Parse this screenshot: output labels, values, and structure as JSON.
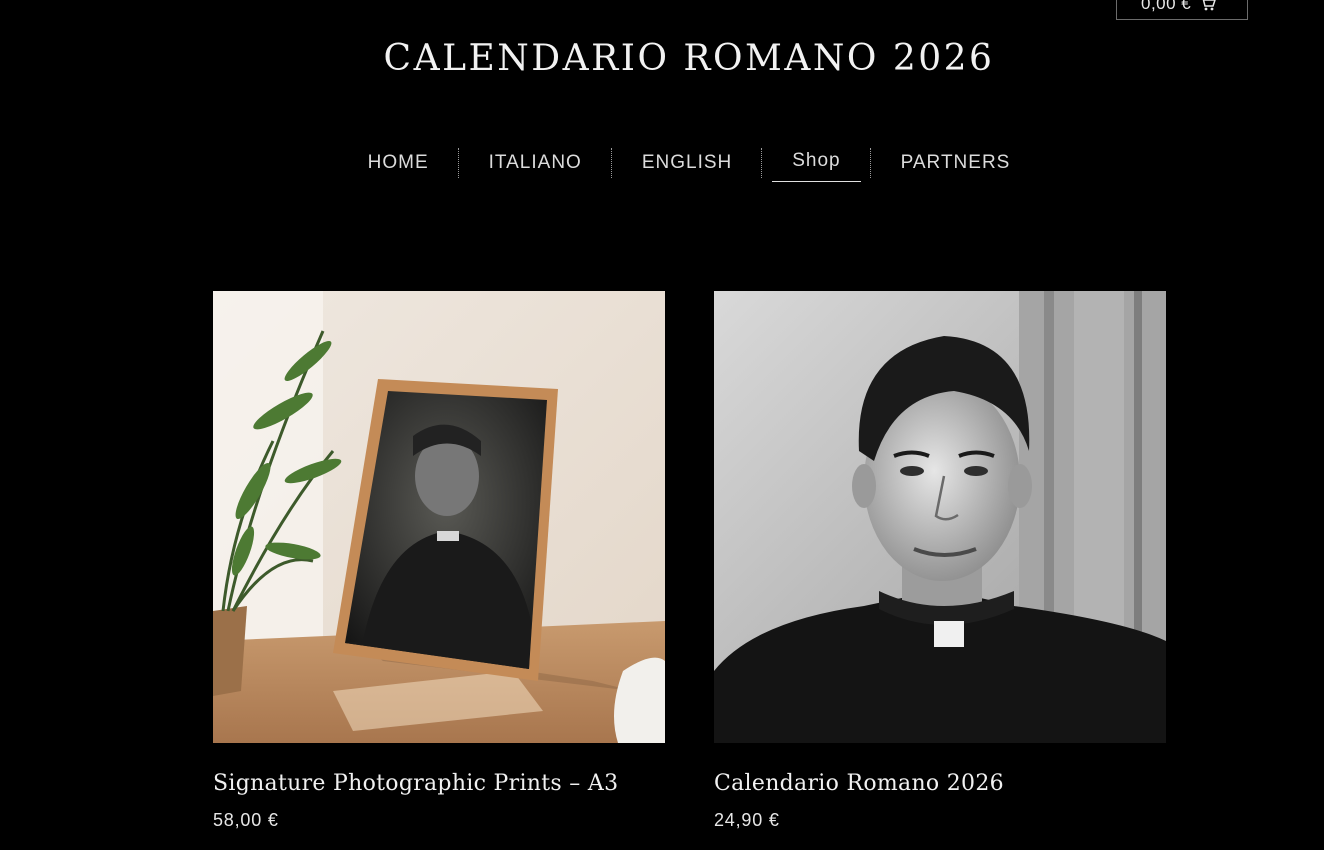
{
  "cart": {
    "total": "0,00 €",
    "icon": "shopping-cart-icon"
  },
  "site": {
    "title": "CALENDARIO ROMANO 2026"
  },
  "nav": {
    "items": [
      {
        "label": "HOME"
      },
      {
        "label": "ITALIANO"
      },
      {
        "label": "ENGLISH"
      },
      {
        "label": "Shop",
        "active": true
      },
      {
        "label": "PARTNERS"
      }
    ]
  },
  "products": [
    {
      "name": "Signature Photographic Prints – A3",
      "price": "58,00 €",
      "image_alt": "Framed black and white portrait leaning against a wall beside a plant"
    },
    {
      "name": "Calendario Romano 2026",
      "price": "24,90 €",
      "image_alt": "Black and white portrait of a smiling young priest"
    }
  ],
  "colors": {
    "background": "#000000",
    "text": "#f2f2f2",
    "border": "#6b6b6b"
  }
}
